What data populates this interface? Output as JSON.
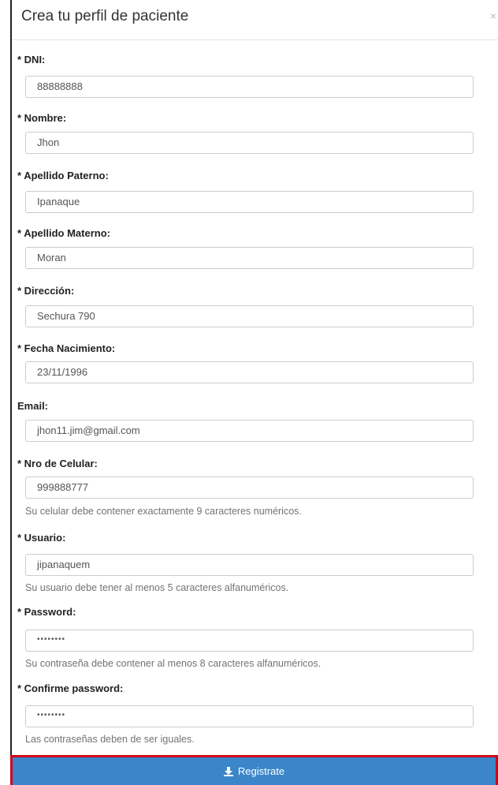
{
  "modal": {
    "title": "Crea tu perfil de paciente",
    "close": "×"
  },
  "fields": {
    "dni": {
      "label": "* DNI:",
      "value": "88888888"
    },
    "nombre": {
      "label": "* Nombre:",
      "value": "Jhon"
    },
    "apellido_paterno": {
      "label": "* Apellido Paterno:",
      "value": "Ipanaque"
    },
    "apellido_materno": {
      "label": "* Apellido Materno:",
      "value": "Moran"
    },
    "direccion": {
      "label": "* Dirección:",
      "value": "Sechura 790"
    },
    "fecha": {
      "label": "* Fecha Nacimiento:",
      "value": "23/11/1996"
    },
    "email": {
      "label": "Email:",
      "value": "jhon11.jim@gmail.com"
    },
    "celular": {
      "label": "* Nro de Celular:",
      "value": "999888777",
      "help": "Su celular debe contener exactamente 9 caracteres numéricos."
    },
    "usuario": {
      "label": "* Usuario:",
      "value": "jipanaquem",
      "help": "Su usuario debe tener al menos 5 caracteres alfanuméricos."
    },
    "password": {
      "label": "* Password:",
      "value": "••••••••",
      "help": "Su contraseña debe contener al menos 8 caracteres alfanuméricos."
    },
    "confirm": {
      "label": "* Confirme password:",
      "value": "••••••••",
      "help": "Las contraseñas deben de ser iguales."
    }
  },
  "submit": {
    "label": "Registrate",
    "icon": "download-icon",
    "color": "#3a86c9",
    "highlight": "#d0021b"
  }
}
